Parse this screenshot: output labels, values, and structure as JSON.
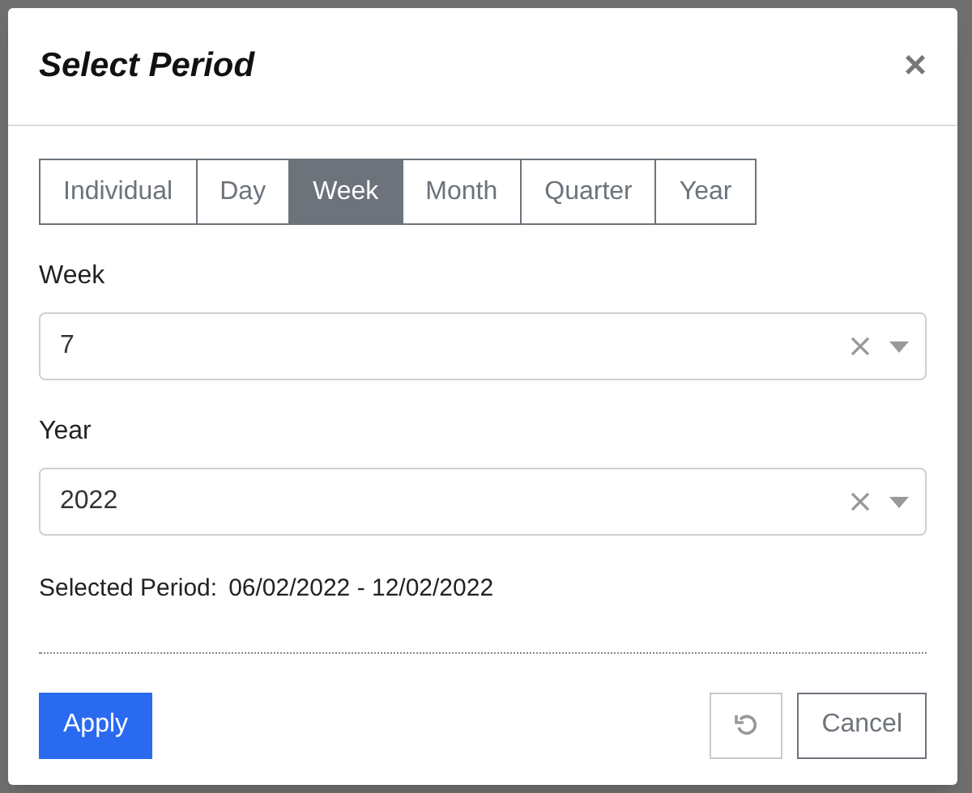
{
  "dialog": {
    "title": "Select Period",
    "close": "×"
  },
  "tabs": [
    {
      "label": "Individual",
      "selected": false
    },
    {
      "label": "Day",
      "selected": false
    },
    {
      "label": "Week",
      "selected": true
    },
    {
      "label": "Month",
      "selected": false
    },
    {
      "label": "Quarter",
      "selected": false
    },
    {
      "label": "Year",
      "selected": false
    }
  ],
  "fields": [
    {
      "label": "Week",
      "value": "7"
    },
    {
      "label": "Year",
      "value": "2022"
    }
  ],
  "selected_period": {
    "label": "Selected Period:",
    "value": "06/02/2022 - 12/02/2022"
  },
  "buttons": {
    "apply": "Apply",
    "cancel": "Cancel"
  }
}
